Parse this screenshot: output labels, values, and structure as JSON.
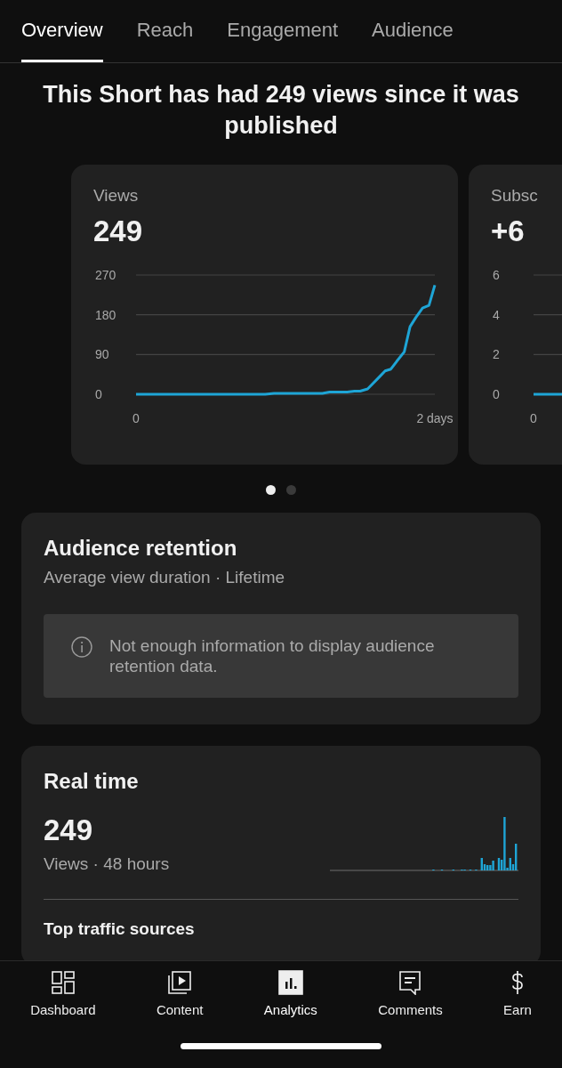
{
  "tabs": [
    {
      "label": "Overview",
      "selected": true
    },
    {
      "label": "Reach",
      "selected": false
    },
    {
      "label": "Engagement",
      "selected": false
    },
    {
      "label": "Audience",
      "selected": false
    }
  ],
  "headline": "This Short has had 249 views since it was published",
  "metric_cards": [
    {
      "title": "Views",
      "value": "249",
      "chart_data": {
        "type": "line",
        "x": [
          0,
          0.865,
          0.924,
          1.247,
          1.295,
          1.413,
          1.462,
          1.5,
          1.55,
          1.628,
          1.667,
          1.706,
          1.746,
          1.795,
          1.834,
          1.873,
          1.918,
          1.961,
          2.0
        ],
        "series": [
          {
            "color": "#1ea5d6",
            "values": [
              0,
              0,
              2,
              2,
              5,
              5,
              7,
              7,
              12,
              39,
              53,
              57,
              75,
              96,
              153,
              174,
              195,
              201,
              247
            ]
          }
        ],
        "xlim": [
          0,
          2
        ],
        "ylim": [
          0,
          270
        ],
        "xticks": [
          {
            "value": 0,
            "label": "0"
          },
          {
            "value": 2,
            "label": "2 days"
          }
        ],
        "yticks": [
          0,
          90,
          180,
          270
        ]
      }
    },
    {
      "title": "Subsc",
      "value": "+6",
      "y_axis_labels": [
        "6",
        "4",
        "2",
        "0"
      ],
      "x_axis_label": "0"
    }
  ],
  "carousel_dots": [
    {
      "selected": true
    },
    {
      "selected": false
    }
  ],
  "retention": {
    "title": "Audience retention",
    "subtitle": "Average view duration · Lifetime",
    "notice": "Not enough information to display audience retention data."
  },
  "realtime": {
    "title": "Real time",
    "value": "249",
    "caption": "Views · 48 hours",
    "section": "Top traffic sources"
  },
  "nav": [
    {
      "label": "Dashboard",
      "kind": "dashboard",
      "selected": false
    },
    {
      "label": "Content",
      "kind": "content",
      "selected": false
    },
    {
      "label": "Analytics",
      "kind": "analytics",
      "selected": true
    },
    {
      "label": "Comments",
      "kind": "comments",
      "selected": false
    },
    {
      "label": "Earn",
      "kind": "earn",
      "selected": false
    }
  ]
}
